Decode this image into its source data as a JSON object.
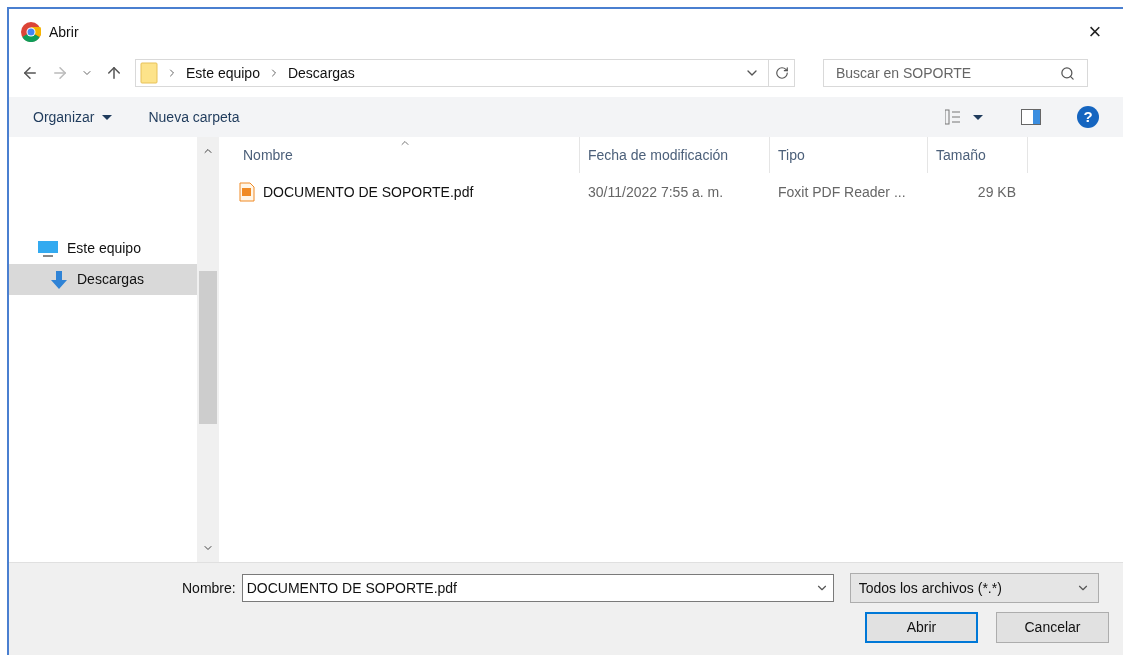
{
  "window": {
    "title": "Abrir",
    "close": "×"
  },
  "address": {
    "path": [
      "Este equipo",
      "Descargas"
    ]
  },
  "search": {
    "placeholder": "Buscar en SOPORTE"
  },
  "toolbar": {
    "organize": "Organizar",
    "new_folder": "Nueva carpeta",
    "help": "?"
  },
  "sidebar": {
    "items": [
      {
        "label": "Este equipo",
        "kind": "computer",
        "selected": false
      },
      {
        "label": "Descargas",
        "kind": "download",
        "selected": true
      }
    ]
  },
  "table": {
    "columns": [
      "Nombre",
      "Fecha de modificación",
      "Tipo",
      "Tamaño"
    ],
    "rows": [
      {
        "name": "DOCUMENTO DE SOPORTE.pdf",
        "modified": "30/11/2022 7:55 a. m.",
        "type": "Foxit PDF Reader ...",
        "size": "29 KB",
        "selected": false
      }
    ]
  },
  "footer": {
    "name_label": "Nombre:",
    "name_value": "DOCUMENTO DE SOPORTE.pdf",
    "filter": "Todos los archivos (*.*)",
    "buttons": [
      {
        "label": "Abrir",
        "kind": "primary"
      },
      {
        "label": "Cancelar",
        "kind": "secondary"
      }
    ]
  }
}
